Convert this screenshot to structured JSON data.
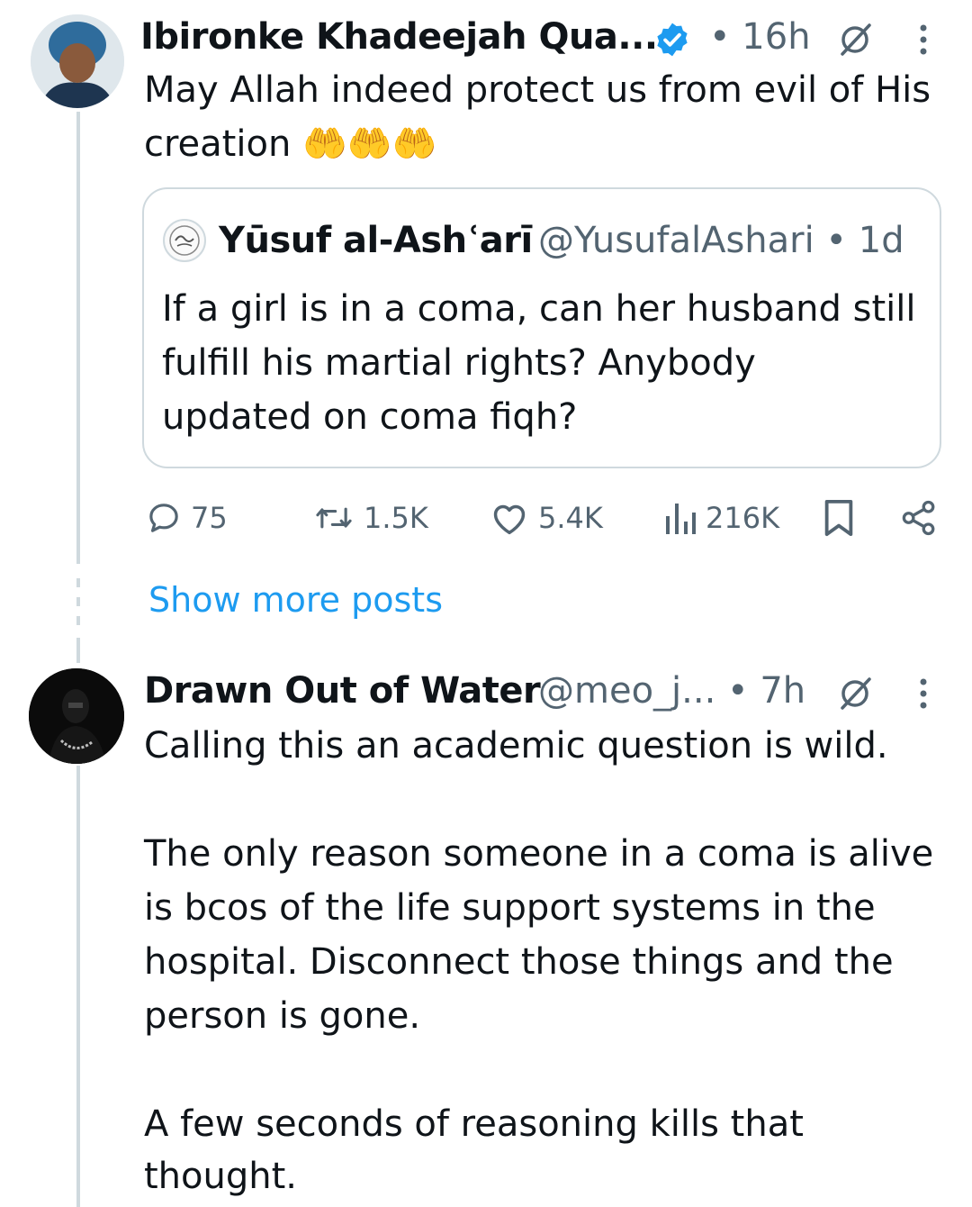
{
  "post1": {
    "author_name": "Ibironke Khadeejah Qua...",
    "verified_icon": "verified-badge-icon",
    "time": "• 16h",
    "text_line1": "May Allah indeed protect us from evil of His",
    "text_line2": "creation 🤲🤲🤲",
    "quote": {
      "author_name": "Yūsuf al-Ashʿarī",
      "handle_time": "@YusufalAshari • 1d",
      "text_line1": "If a girl is in a coma, can her husband still",
      "text_line2": "fulfill his martial rights? Anybody",
      "text_line3": "updated on coma fiqh?"
    },
    "actions": {
      "replies": "75",
      "reposts": "1.5K",
      "likes": "5.4K",
      "views": "216K"
    }
  },
  "show_more": "Show more posts",
  "post2": {
    "author_name": "Drawn Out of Water",
    "handle_time": "@meo_j... • 7h",
    "para1": "Calling this an academic question is wild.",
    "para2_line1": "The only reason someone in a coma is alive",
    "para2_line2": "is bcos of the life support systems in the",
    "para2_line3": "hospital. Disconnect those things and the",
    "para2_line4": "person is gone.",
    "para3_line1": "A few seconds of reasoning kills that",
    "para3_line2": "thought."
  },
  "colors": {
    "accent": "#1d9bf0",
    "muted": "#536471",
    "border": "#cfd9de",
    "text": "#0f1419"
  }
}
